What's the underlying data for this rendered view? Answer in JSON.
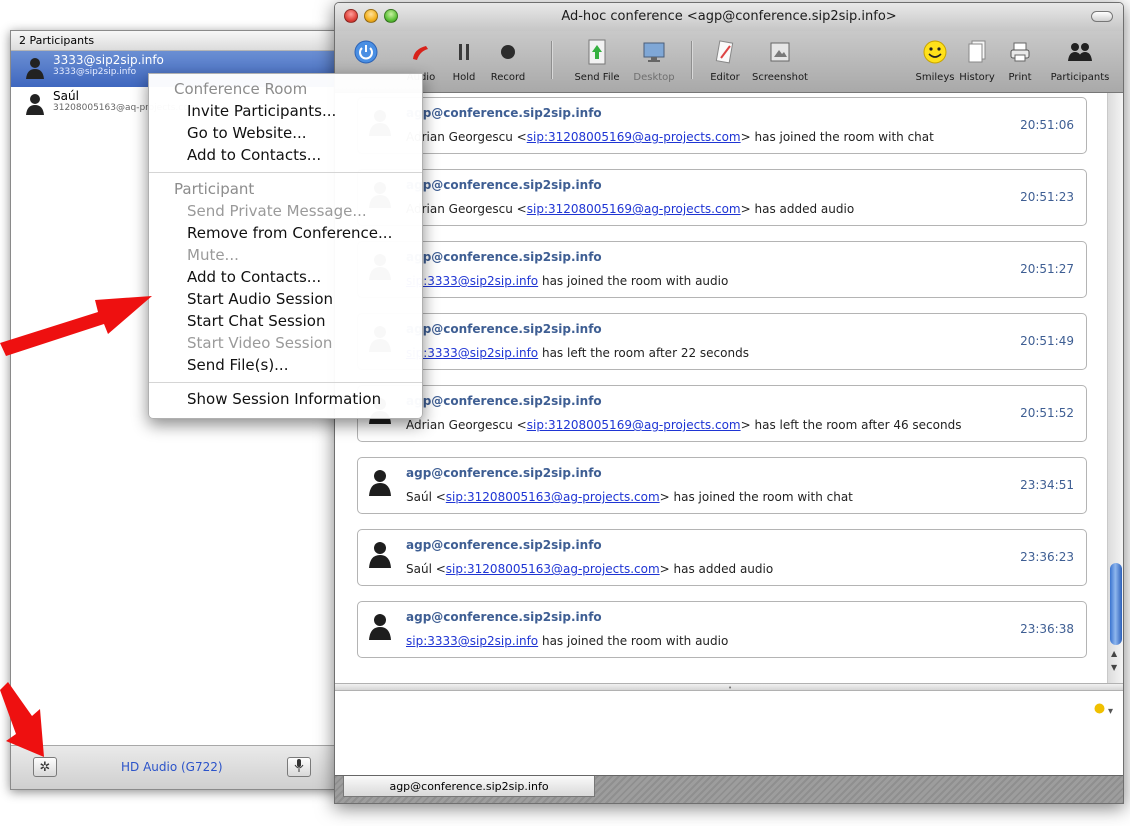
{
  "participants": {
    "header": "2 Participants",
    "items": [
      {
        "name": "3333@sip2sip.info",
        "address": "3333@sip2sip.info"
      },
      {
        "name": "Saúl",
        "address": "31208005163@aq-projects.com"
      }
    ],
    "codec": "HD Audio (G722)"
  },
  "window": {
    "title": "Ad-hoc conference <agp@conference.sip2sip.info>"
  },
  "toolbar": {
    "items": [
      {
        "label": "Audio",
        "icon": "phone-icon"
      },
      {
        "label": "Hold",
        "icon": "pause-icon"
      },
      {
        "label": "Record",
        "icon": "record-icon"
      },
      {
        "label": "Send File",
        "icon": "send-file-icon"
      },
      {
        "label": "Desktop",
        "icon": "desktop-icon"
      },
      {
        "label": "Editor",
        "icon": "editor-icon"
      },
      {
        "label": "Screenshot",
        "icon": "screenshot-icon"
      },
      {
        "label": "Smileys",
        "icon": "smiley-icon"
      },
      {
        "label": "History",
        "icon": "history-icon"
      },
      {
        "label": "Print",
        "icon": "print-icon"
      },
      {
        "label": "Participants",
        "icon": "participants-icon"
      }
    ]
  },
  "messages": [
    {
      "from": "agp@conference.sip2sip.info",
      "pre": "Adrian Georgescu <",
      "link": "sip:31208005169@ag-projects.com",
      "post": "> has joined the room with chat",
      "time": "20:51:06"
    },
    {
      "from": "agp@conference.sip2sip.info",
      "pre": "Adrian Georgescu <",
      "link": "sip:31208005169@ag-projects.com",
      "post": "> has added audio",
      "time": "20:51:23"
    },
    {
      "from": "agp@conference.sip2sip.info",
      "pre": "",
      "link": "sip:3333@sip2sip.info",
      "post": " has joined the room with audio",
      "time": "20:51:27"
    },
    {
      "from": "agp@conference.sip2sip.info",
      "pre": "",
      "link": "sip:3333@sip2sip.info",
      "post": " has left the room after 22 seconds",
      "time": "20:51:49"
    },
    {
      "from": "agp@conference.sip2sip.info",
      "pre": "Adrian Georgescu <",
      "link": "sip:31208005169@ag-projects.com",
      "post": "> has left the room after 46 seconds",
      "time": "20:51:52"
    },
    {
      "from": "agp@conference.sip2sip.info",
      "pre": "Saúl <",
      "link": "sip:31208005163@ag-projects.com",
      "post": "> has joined the room with chat",
      "time": "23:34:51"
    },
    {
      "from": "agp@conference.sip2sip.info",
      "pre": "Saúl <",
      "link": "sip:31208005163@ag-projects.com",
      "post": "> has added audio",
      "time": "23:36:23"
    },
    {
      "from": "agp@conference.sip2sip.info",
      "pre": "",
      "link": "sip:3333@sip2sip.info",
      "post": " has joined the room with audio",
      "time": "23:36:38"
    }
  ],
  "tab": {
    "label": "agp@conference.sip2sip.info"
  },
  "context_menu": {
    "conference_header": "Conference Room",
    "conference_items": [
      {
        "label": "Invite Participants...",
        "enabled": true
      },
      {
        "label": "Go to Website...",
        "enabled": true
      },
      {
        "label": "Add to Contacts...",
        "enabled": true
      }
    ],
    "participant_header": "Participant",
    "participant_items": [
      {
        "label": "Send Private Message...",
        "enabled": false
      },
      {
        "label": "Remove from Conference...",
        "enabled": true
      },
      {
        "label": "Mute...",
        "enabled": false
      },
      {
        "label": "Add to Contacts...",
        "enabled": true
      },
      {
        "label": "Start Audio Session",
        "enabled": true
      },
      {
        "label": "Start Chat Session",
        "enabled": true
      },
      {
        "label": "Start Video Session",
        "enabled": false
      },
      {
        "label": "Send File(s)...",
        "enabled": true
      }
    ],
    "info_item": "Show Session Information"
  },
  "colors": {
    "selection": "#3f67bf",
    "link": "#1f35d4",
    "sender": "#3e5e93",
    "annotation_arrow": "#ee1010"
  }
}
